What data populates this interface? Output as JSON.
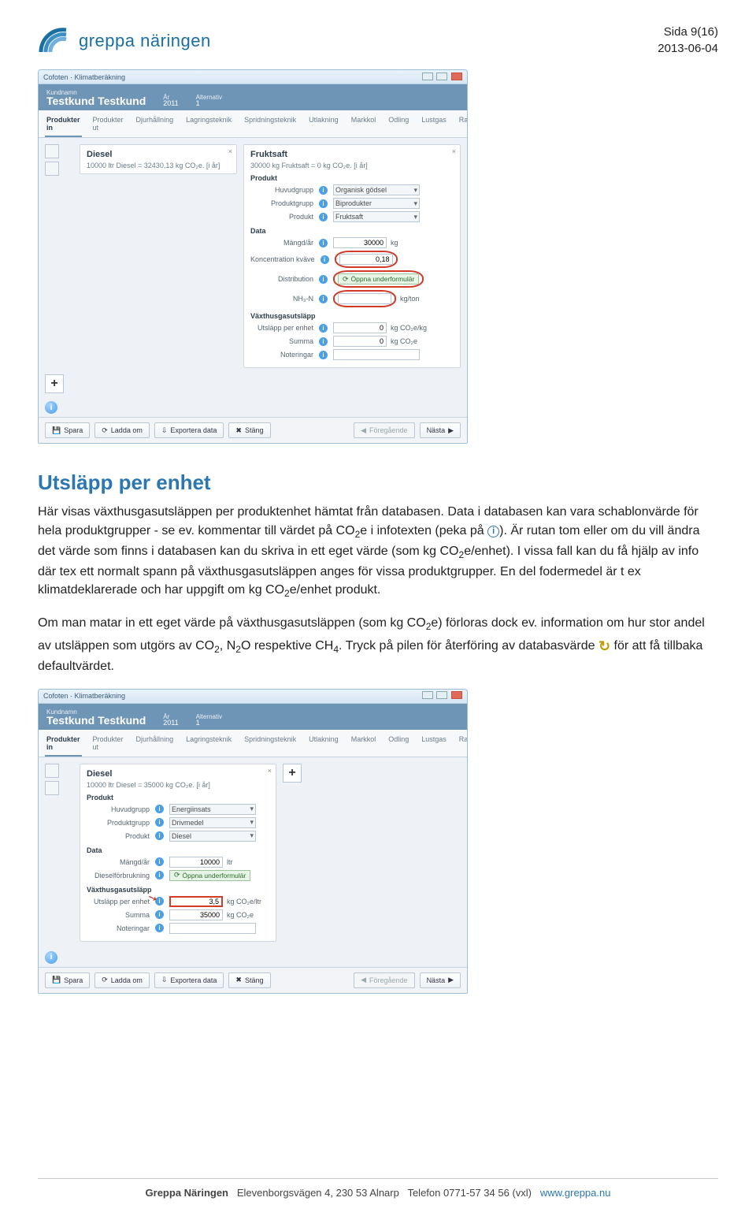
{
  "header": {
    "logo_text": "greppa näringen",
    "page_label": "Sida 9(16)",
    "date": "2013-06-04"
  },
  "app1": {
    "titlebar": "Cofoten · Klimatberäkning",
    "customer_label": "Kundnamn",
    "customer_name": "Testkund Testkund",
    "year_label": "År",
    "year": "2011",
    "alt_label": "Alternativ",
    "alt": "1",
    "tabs": [
      "Produkter in",
      "Produkter ut",
      "Djurhållning",
      "Lagringsteknik",
      "Spridningsteknik",
      "Utlakning",
      "Markkol",
      "Odling",
      "Lustgas",
      "Rapporter"
    ],
    "left_card_title": "Diesel",
    "left_card_sub": "10000 ltr Diesel = 32430,13 kg CO₂e. [i år]",
    "right_card_title": "Fruktsaft",
    "right_card_sub": "30000 kg Fruktsaft = 0 kg CO₂e. [i år]",
    "sec_prod": "Produkt",
    "lbl_huvudgrupp": "Huvudgrupp",
    "val_huvudgrupp": "Organisk gödsel",
    "lbl_prodgrupp": "Produktgrupp",
    "val_prodgrupp": "Biprodukter",
    "lbl_produkt": "Produkt",
    "val_produkt": "Fruktsaft",
    "sec_data": "Data",
    "lbl_mangd": "Mängd/år",
    "val_mangd": "30000",
    "unit_mangd": "kg",
    "lbl_konc": "Koncentration kväve",
    "val_konc": "0,18",
    "lbl_dist": "Distribution",
    "btn_open": "Öppna underformulär",
    "lbl_nh3n": "NH₃-N",
    "unit_nh3n": "kg/ton",
    "sec_vhu": "Växthusgasutsläpp",
    "lbl_upp": "Utsläpp per enhet",
    "val_upp": "0",
    "unit_upp": "kg CO₂e/kg",
    "lbl_summa": "Summa",
    "val_summa": "0",
    "unit_summa": "kg CO₂e",
    "lbl_not": "Noteringar",
    "footer": {
      "spara": "Spara",
      "ladda": "Ladda om",
      "export": "Exportera data",
      "stang": "Stäng",
      "prev": "Föregående",
      "next": "Nästa"
    }
  },
  "body": {
    "heading": "Utsläpp per enhet",
    "p1a": "Här visas växthusgasutsläppen per produktenhet hämtat från databasen. Data i databasen kan vara schablonvärde för hela produktgrupper - se ev. kommentar till värdet på CO",
    "p1b": "e i infotexten (peka på ",
    "p1c": "). Är rutan tom eller om du vill ändra det värde som finns i databasen kan du skriva in ett eget värde (som kg CO",
    "p1d": "e/enhet). I vissa fall kan du få hjälp av info där tex ett normalt spann på växthusgasutsläppen anges för vissa produktgrupper. En del fodermedel är t ex klimatdeklarerade och har uppgift om kg CO",
    "p1e": "e/enhet produkt.",
    "p2a": "Om man matar in ett eget värde på växthusgasutsläppen (som kg CO",
    "p2b": "e) förloras dock ev. information om hur stor andel av utsläppen som utgörs av CO",
    "p2c": ", N",
    "p2d": "O respektive CH",
    "p2e": ". Tryck på pilen för återföring av databasvärde ",
    "p2f": " för att få tillbaka defaultvärdet."
  },
  "app2": {
    "left_card_title": "Diesel",
    "left_card_sub": "10000 ltr Diesel = 35000 kg CO₂e. [i år]",
    "sec_prod": "Produkt",
    "lbl_huvudgrupp": "Huvudgrupp",
    "val_huvudgrupp": "Energiinsats",
    "lbl_prodgrupp": "Produktgrupp",
    "val_prodgrupp": "Drivmedel",
    "lbl_produkt": "Produkt",
    "val_produkt": "Diesel",
    "sec_data": "Data",
    "lbl_mangd": "Mängd/år",
    "val_mangd": "10000",
    "unit_mangd": "ltr",
    "lbl_diesel": "Dieselförbrukning",
    "sec_vhu": "Växthusgasutsläpp",
    "lbl_upp": "Utsläpp per enhet",
    "val_upp": "3,5",
    "unit_upp": "kg CO₂e/ltr",
    "lbl_summa": "Summa",
    "val_summa": "35000",
    "unit_summa": "kg CO₂e",
    "lbl_not": "Noteringar"
  },
  "footer": {
    "org": "Greppa Näringen",
    "addr": "Elevenborgsvägen 4, 230 53 Alnarp",
    "tel": "Telefon 0771-57 34 56 (vxl)",
    "url": "www.greppa.nu"
  }
}
